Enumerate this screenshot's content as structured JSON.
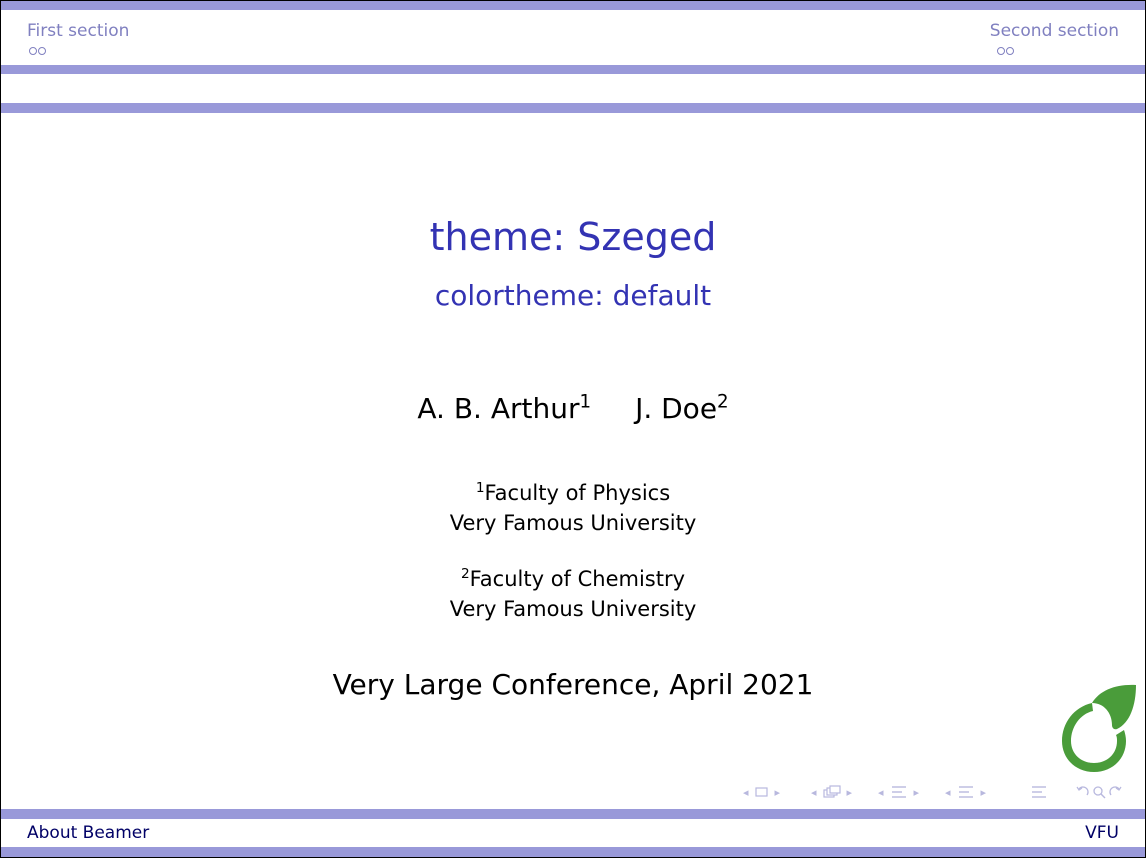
{
  "header": {
    "left_section": "First section",
    "right_section": "Second section"
  },
  "title_page": {
    "title": "theme: Szeged",
    "subtitle": "colortheme: default",
    "authors": [
      {
        "name": "A. B. Arthur",
        "mark": "1"
      },
      {
        "name": "J. Doe",
        "mark": "2"
      }
    ],
    "institutes": [
      {
        "mark": "1",
        "line1": "Faculty of Physics",
        "line2": "Very Famous University"
      },
      {
        "mark": "2",
        "line1": "Faculty of Chemistry",
        "line2": "Very Famous University"
      }
    ],
    "date": "Very Large Conference, April 2021"
  },
  "footer": {
    "left_text": "About Beamer",
    "right_text": "VFU"
  },
  "navigation_symbols": [
    "slide-nav",
    "frame-nav",
    "subsection-nav",
    "section-nav",
    "document-nav",
    "search"
  ],
  "logo": {
    "icon": "leaf-logo-icon",
    "color": "#4a9c3a"
  },
  "colors": {
    "bars": "#9999d9",
    "title": "#3333b3",
    "header_text": "#8080c0",
    "footer_text": "#000066"
  }
}
